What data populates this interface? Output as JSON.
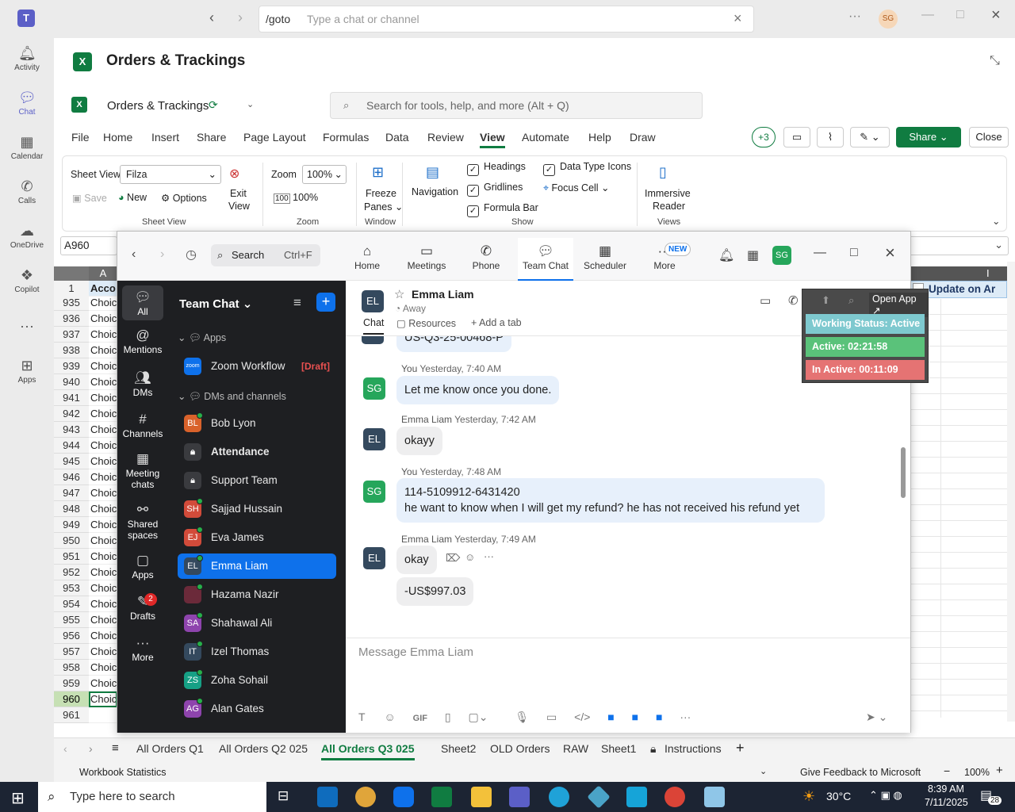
{
  "teams": {
    "goto_label": "/goto",
    "goto_placeholder": "Type a chat or channel",
    "user_initials": "SG",
    "rail": [
      {
        "label": "Activity",
        "icon": "bell-icon"
      },
      {
        "label": "Chat",
        "icon": "chat-icon"
      },
      {
        "label": "Calendar",
        "icon": "calendar-icon"
      },
      {
        "label": "Calls",
        "icon": "phone-icon"
      },
      {
        "label": "OneDrive",
        "icon": "cloud-icon"
      },
      {
        "label": "Copilot",
        "icon": "copilot-icon"
      },
      {
        "label": "Apps",
        "icon": "apps-icon"
      }
    ]
  },
  "excel": {
    "title": "Orders & Trackings",
    "doc_title": "Orders & Trackings",
    "search_placeholder": "Search for tools, help, and more (Alt + Q)",
    "menu": [
      "File",
      "Home",
      "Insert",
      "Share",
      "Page Layout",
      "Formulas",
      "Data",
      "Review",
      "View",
      "Automate",
      "Help",
      "Draw"
    ],
    "active_menu": "View",
    "plus_count": "+3",
    "share_label": "Share",
    "close_label": "Close",
    "ribbon": {
      "sheet_view_label": "Sheet View",
      "sheet_view_value": "Filza",
      "save": "Save",
      "new": "New",
      "options": "Options",
      "exit_view_1": "Exit",
      "exit_view_2": "View",
      "group_sheet_view": "Sheet View",
      "zoom_label": "Zoom",
      "zoom_value": "100%",
      "zoom_100": "100%",
      "group_zoom": "Zoom",
      "freeze_1": "Freeze",
      "freeze_2": "Panes",
      "group_window": "Window",
      "navigation": "Navigation",
      "headings": "Headings",
      "gridlines": "Gridlines",
      "formula_bar": "Formula Bar",
      "data_type_icons": "Data Type Icons",
      "focus_cell": "Focus Cell",
      "group_show": "Show",
      "immersive_1": "Immersive",
      "immersive_2": "Reader",
      "group_views": "Views"
    },
    "name_box": "A960",
    "col_header_a": "A",
    "col_header_i": "I",
    "header_cell": "Acco",
    "header_right": "Update on Ar",
    "rows": [
      "1",
      "935",
      "936",
      "937",
      "938",
      "939",
      "940",
      "941",
      "942",
      "943",
      "944",
      "945",
      "946",
      "947",
      "948",
      "949",
      "950",
      "951",
      "952",
      "953",
      "954",
      "955",
      "956",
      "957",
      "958",
      "959",
      "960",
      "961"
    ],
    "cell_text": "Choice",
    "sheets": [
      "All Orders Q1",
      "All Orders Q2 025",
      "All Orders Q3 025",
      "Sheet2",
      "OLD Orders",
      "RAW",
      "Sheet1",
      "Instructions"
    ],
    "active_sheet": "All Orders Q3 025",
    "status_left": "Workbook Statistics",
    "status_feedback": "Give Feedback to Microsoft",
    "status_zoom": "100%"
  },
  "zoom": {
    "search_label": "Search",
    "search_shortcut": "Ctrl+F",
    "tabs": [
      {
        "label": "Home",
        "icon": "home-icon"
      },
      {
        "label": "Meetings",
        "icon": "video-icon"
      },
      {
        "label": "Phone",
        "icon": "phone-icon"
      },
      {
        "label": "Team Chat",
        "icon": "chat-icon"
      },
      {
        "label": "Scheduler",
        "icon": "calendar-icon"
      },
      {
        "label": "More",
        "icon": "more-icon"
      }
    ],
    "new_badge": "NEW",
    "avatar": "SG",
    "left_nav": [
      {
        "label": "All",
        "icon": "chat-icon"
      },
      {
        "label": "Mentions",
        "icon": "at-icon"
      },
      {
        "label": "DMs",
        "icon": "people-icon"
      },
      {
        "label": "Channels",
        "icon": "hash-icon"
      },
      {
        "label": "Meeting chats",
        "icon": "calendar-icon"
      },
      {
        "label": "Shared spaces",
        "icon": "share-icon"
      },
      {
        "label": "Apps",
        "icon": "apps-icon"
      },
      {
        "label": "Drafts",
        "icon": "draft-icon"
      },
      {
        "label": "More",
        "icon": "more-icon"
      }
    ],
    "drafts_count": "2",
    "list_title": "Team Chat",
    "section_apps": "Apps",
    "section_dms": "DMs and channels",
    "workflow": "Zoom Workflow",
    "workflow_tag": "[Draft]",
    "contacts": [
      {
        "name": "Bob Lyon",
        "initials": "BL",
        "color": "#d9622b"
      },
      {
        "name": "Attendance",
        "initials": "",
        "color": "#3a3b3f"
      },
      {
        "name": "Support Team",
        "initials": "",
        "color": "#3a3b3f"
      },
      {
        "name": "Sajjad Hussain",
        "initials": "SH",
        "color": "#d24b3a"
      },
      {
        "name": "Eva James",
        "initials": "EJ",
        "color": "#d24b3a"
      },
      {
        "name": "Emma Liam",
        "initials": "EL",
        "color": "#34495e"
      },
      {
        "name": "Hazama Nazir",
        "initials": "",
        "color": "#6b2a3a"
      },
      {
        "name": "Shahawal Ali",
        "initials": "SA",
        "color": "#8e44ad"
      },
      {
        "name": "Izel Thomas",
        "initials": "IT",
        "color": "#34495e"
      },
      {
        "name": "Zoha Sohail",
        "initials": "ZS",
        "color": "#16a085"
      },
      {
        "name": "Alan Gates",
        "initials": "AG",
        "color": "#8e44ad"
      }
    ],
    "chat": {
      "name": "Emma Liam",
      "initials": "EL",
      "presence": "Away",
      "tab_chat": "Chat",
      "tab_resources": "Resources",
      "add_tab": "Add a tab",
      "cut_message": "US-Q3-25-00468-P",
      "messages": [
        {
          "sender": "You",
          "time": "Yesterday, 7:40 AM",
          "lines": [
            "Let me know once you done."
          ]
        },
        {
          "sender": "Emma Liam",
          "time": "Yesterday, 7:42 AM",
          "lines": [
            "okayy"
          ]
        },
        {
          "sender": "You",
          "time": "Yesterday, 7:48 AM",
          "lines": [
            "114-5109912-6431420",
            "he want to  know when I will get my refund? he has not received his refund yet"
          ]
        },
        {
          "sender": "Emma Liam",
          "time": "Yesterday, 7:49 AM",
          "lines": [
            "okay",
            "-US$997.03"
          ]
        }
      ],
      "composer_placeholder": "Message Emma Liam"
    }
  },
  "widget": {
    "open_app": "Open App",
    "working_status": "Working Status: Active",
    "active": "Active: 02:21:58",
    "inactive": "In Active: 00:11:09"
  },
  "taskbar": {
    "search_placeholder": "Type here to search",
    "temperature": "30°C",
    "time": "8:39 AM",
    "date": "7/11/2025",
    "notif_count": "28"
  }
}
